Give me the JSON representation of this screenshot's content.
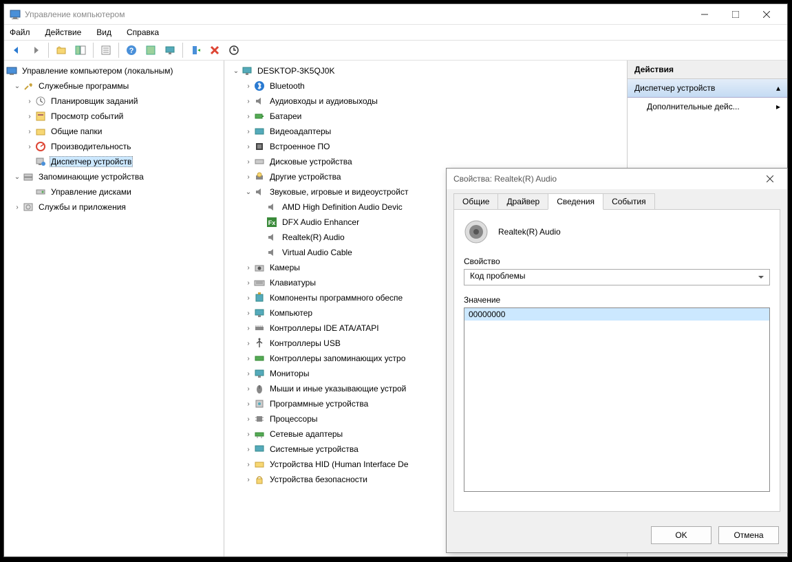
{
  "window": {
    "title": "Управление компьютером"
  },
  "menu": {
    "file": "Файл",
    "action": "Действие",
    "view": "Вид",
    "help": "Справка"
  },
  "left_tree": {
    "root": "Управление компьютером (локальным)",
    "system_tools": "Служебные программы",
    "task_scheduler": "Планировщик заданий",
    "event_viewer": "Просмотр событий",
    "shared_folders": "Общие папки",
    "performance": "Производительность",
    "device_manager": "Диспетчер устройств",
    "storage": "Запоминающие устройства",
    "disk_management": "Управление дисками",
    "services_apps": "Службы и приложения"
  },
  "mid_tree": {
    "computer": "DESKTOP-3K5QJ0K",
    "bluetooth": "Bluetooth",
    "audio_io": "Аудиовходы и аудиовыходы",
    "batteries": "Батареи",
    "display": "Видеоадаптеры",
    "firmware": "Встроенное ПО",
    "disk_drives": "Дисковые устройства",
    "other_devices": "Другие устройства",
    "sound_video": "Звуковые, игровые и видеоустройст",
    "amd_audio": "AMD High Definition Audio Devic",
    "dfx": "DFX Audio Enhancer",
    "realtek": "Realtek(R) Audio",
    "vac": "Virtual Audio Cable",
    "cameras": "Камеры",
    "keyboards": "Клавиатуры",
    "software_components": "Компоненты программного обеспе",
    "computer_cat": "Компьютер",
    "ide": "Контроллеры IDE ATA/ATAPI",
    "usb": "Контроллеры USB",
    "storage_controllers": "Контроллеры запоминающих устро",
    "monitors": "Мониторы",
    "mice": "Мыши и иные указывающие устрой",
    "software_devices": "Программные устройства",
    "processors": "Процессоры",
    "network": "Сетевые адаптеры",
    "system_devices": "Системные устройства",
    "hid": "Устройства HID (Human Interface De",
    "security": "Устройства безопасности"
  },
  "actions": {
    "header": "Действия",
    "main": "Диспетчер устройств",
    "more": "Дополнительные дейс..."
  },
  "dialog": {
    "title": "Свойства: Realtek(R) Audio",
    "tab_general": "Общие",
    "tab_driver": "Драйвер",
    "tab_details": "Сведения",
    "tab_events": "События",
    "device_name": "Realtek(R) Audio",
    "property_label": "Свойство",
    "property_value": "Код проблемы",
    "value_label": "Значение",
    "value": "00000000",
    "ok": "OK",
    "cancel": "Отмена"
  }
}
